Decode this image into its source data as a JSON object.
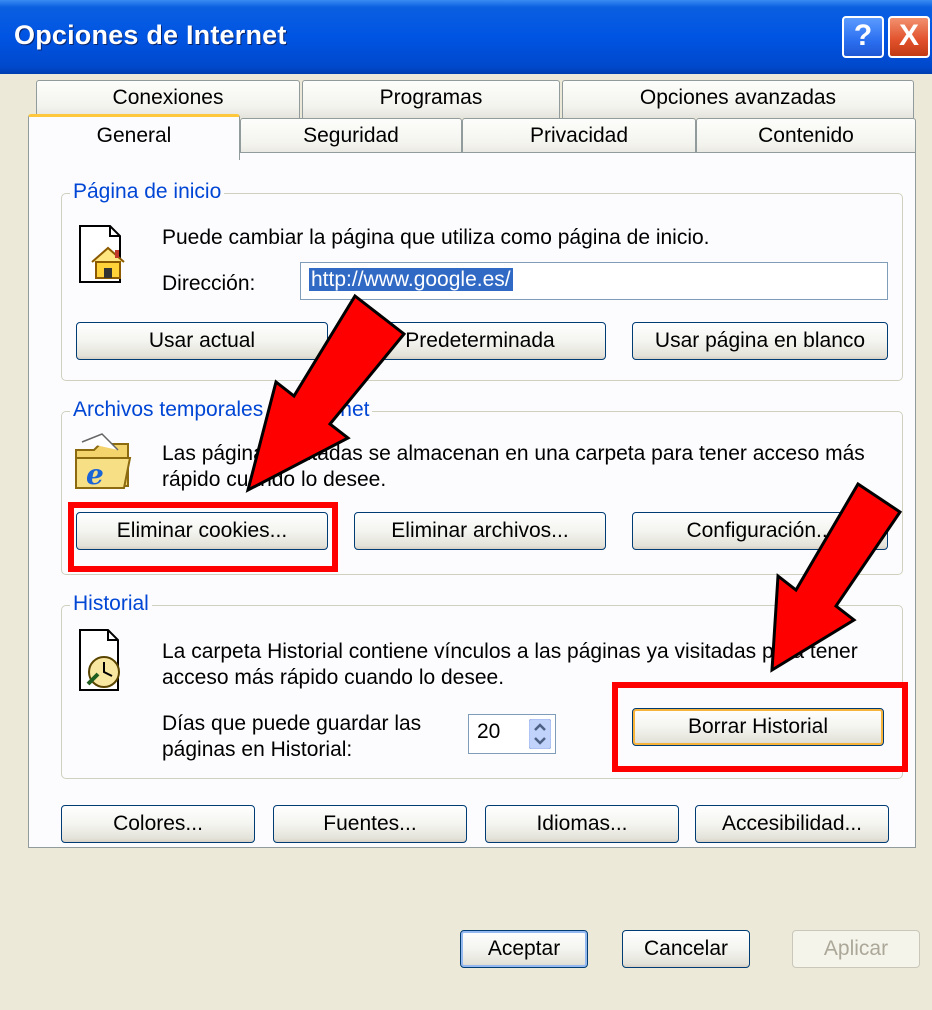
{
  "title_bar": {
    "title": "Opciones de Internet",
    "help_label": "?",
    "close_label": "X"
  },
  "tabs": {
    "row1": [
      {
        "label": "Conexiones"
      },
      {
        "label": "Programas"
      },
      {
        "label": "Opciones avanzadas"
      }
    ],
    "row2": [
      {
        "label": "General",
        "active": true
      },
      {
        "label": "Seguridad"
      },
      {
        "label": "Privacidad"
      },
      {
        "label": "Contenido"
      }
    ]
  },
  "home_page": {
    "legend": "Página de inicio",
    "description": "Puede cambiar la página que utiliza como página de inicio.",
    "address_label": "Dirección:",
    "address_value": "http://www.google.es/",
    "buttons": {
      "use_current": "Usar actual",
      "use_default": "Predeterminada",
      "use_blank": "Usar página en blanco"
    }
  },
  "temp_files": {
    "legend": "Archivos temporales de Internet",
    "description_line1": "Las páginas visitadas se almacenan en una carpeta para tener acceso más",
    "description_line2": "rápido cuando lo desee.",
    "buttons": {
      "delete_cookies": "Eliminar cookies...",
      "delete_files": "Eliminar archivos...",
      "settings": "Configuración..."
    }
  },
  "history": {
    "legend": "Historial",
    "description_line1": "La carpeta Historial contiene vínculos a las páginas ya visitadas para tener",
    "description_line2": "acceso más rápido cuando lo desee.",
    "days_label_line1": "Días que puede guardar las",
    "days_label_line2": "páginas en Historial:",
    "days_value": "20",
    "clear_button": "Borrar Historial"
  },
  "bottom_buttons": {
    "colors": "Colores...",
    "fonts": "Fuentes...",
    "languages": "Idiomas...",
    "accessibility": "Accesibilidad..."
  },
  "dialog_buttons": {
    "ok": "Aceptar",
    "cancel": "Cancelar",
    "apply": "Aplicar"
  },
  "annotation": {
    "highlight_color": "#ff0000",
    "arrow_color": "#ff0000"
  },
  "icons": [
    "home-page-icon",
    "ie-folder-icon",
    "history-clock-icon",
    "help-icon",
    "close-icon",
    "spinner-up-icon",
    "spinner-down-icon",
    "red-arrow-icon"
  ]
}
